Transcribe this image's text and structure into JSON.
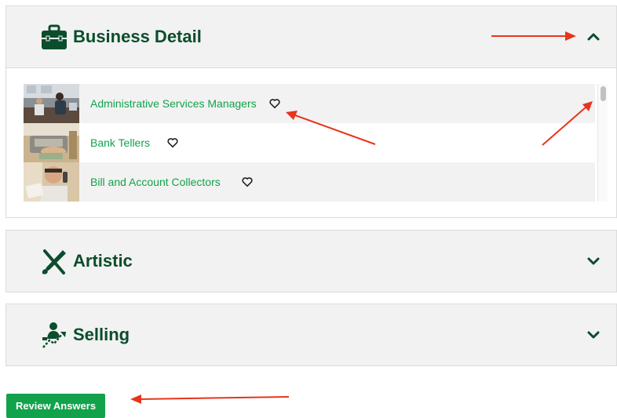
{
  "panels": {
    "business": {
      "title": "Business Detail",
      "icon": "briefcase-icon",
      "expanded": true
    },
    "artistic": {
      "title": "Artistic",
      "icon": "brush-pencil-icon",
      "expanded": false
    },
    "selling": {
      "title": "Selling",
      "icon": "salesperson-icon",
      "expanded": false
    }
  },
  "occupations": [
    {
      "label": "Administrative Services Managers",
      "thumbnail": "office-workers-photo"
    },
    {
      "label": "Bank Tellers",
      "thumbnail": "cash-counting-photo"
    },
    {
      "label": "Bill and Account Collectors",
      "thumbnail": "man-on-phone-photo"
    }
  ],
  "actions": {
    "review_label": "Review Answers"
  },
  "colors": {
    "brand_dark": "#0b4d2c",
    "link_green": "#12a24b",
    "header_bg": "#f2f2f2",
    "annotation_red": "#e8341c"
  }
}
